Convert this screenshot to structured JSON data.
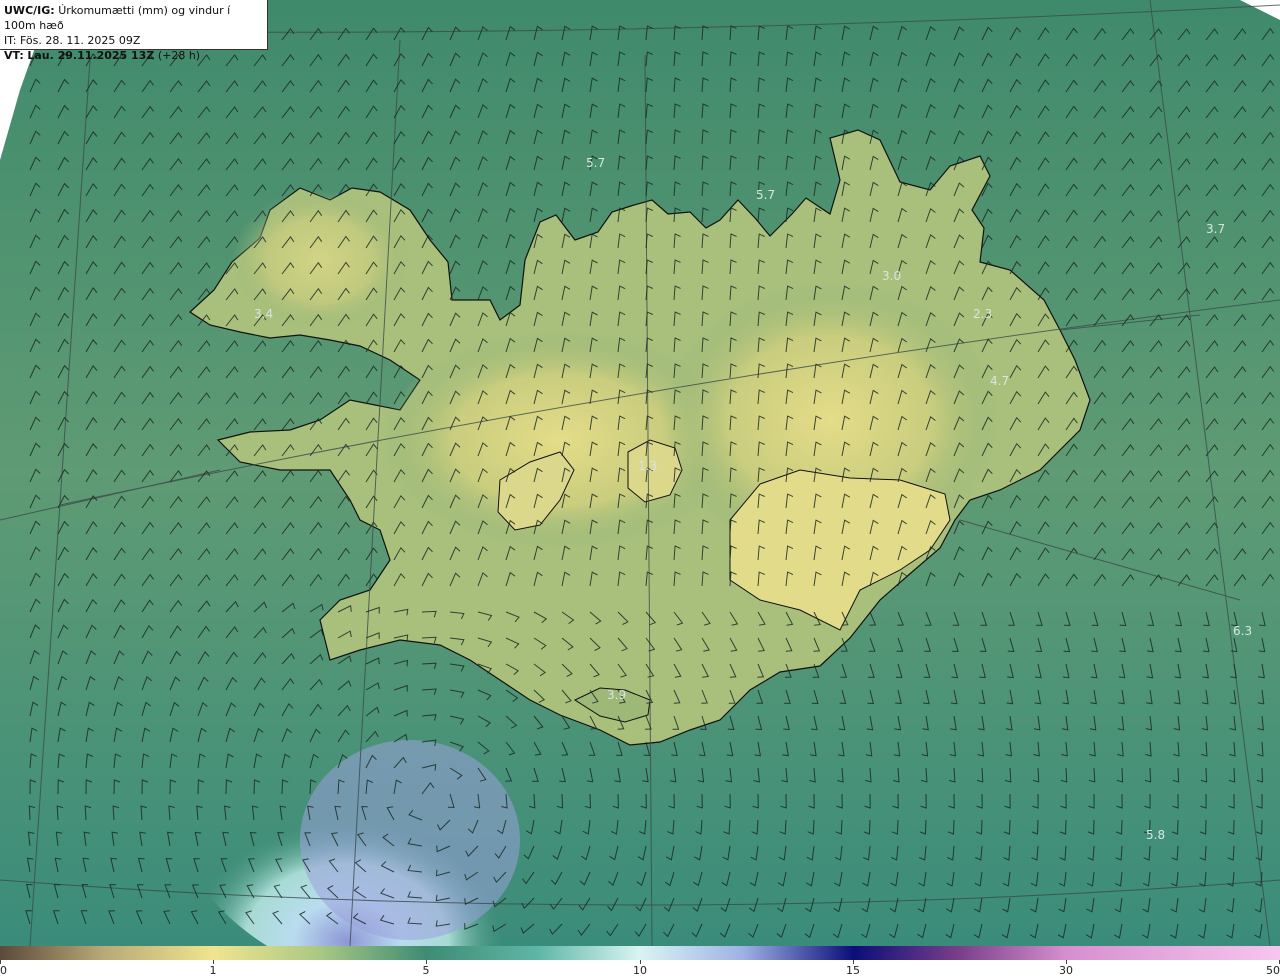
{
  "header": {
    "product": "UWC/IG:",
    "title": "Úrkomumætti (mm) og vindur í 100m hæð",
    "issue_time": "IT: Fös. 28. 11. 2025 09Z",
    "valid_time_prefix": "VT:",
    "valid_time": "Lau. 29.11.2025 13Z",
    "lead": "(+28 h)"
  },
  "colorbar": {
    "ticks": [
      "0",
      "1",
      "5",
      "10",
      "15",
      "30",
      "50"
    ],
    "tick_values": [
      0,
      1,
      5,
      10,
      15,
      30,
      50
    ]
  },
  "map_labels": [
    {
      "id": "lbl-1",
      "text": "5.7"
    },
    {
      "id": "lbl-2",
      "text": "5.7"
    },
    {
      "id": "lbl-3",
      "text": "3.7"
    },
    {
      "id": "lbl-4",
      "text": "3.0"
    },
    {
      "id": "lbl-5",
      "text": "2.3"
    },
    {
      "id": "lbl-6",
      "text": "4.7"
    },
    {
      "id": "lbl-7",
      "text": "3.4"
    },
    {
      "id": "lbl-8",
      "text": "1.3"
    },
    {
      "id": "lbl-9",
      "text": "6.3"
    },
    {
      "id": "lbl-10",
      "text": "3.9"
    },
    {
      "id": "lbl-11",
      "text": "5.8"
    }
  ],
  "colors": {
    "low_dry": "#e6dd8a",
    "mid": "#6f9e6f",
    "sea": "#2f7d6c",
    "wet": "#cdeef2",
    "very_wet": "#9aa3dc",
    "coast": "#111111",
    "grid": "#3b4a4a",
    "barb": "#1c2a24"
  }
}
